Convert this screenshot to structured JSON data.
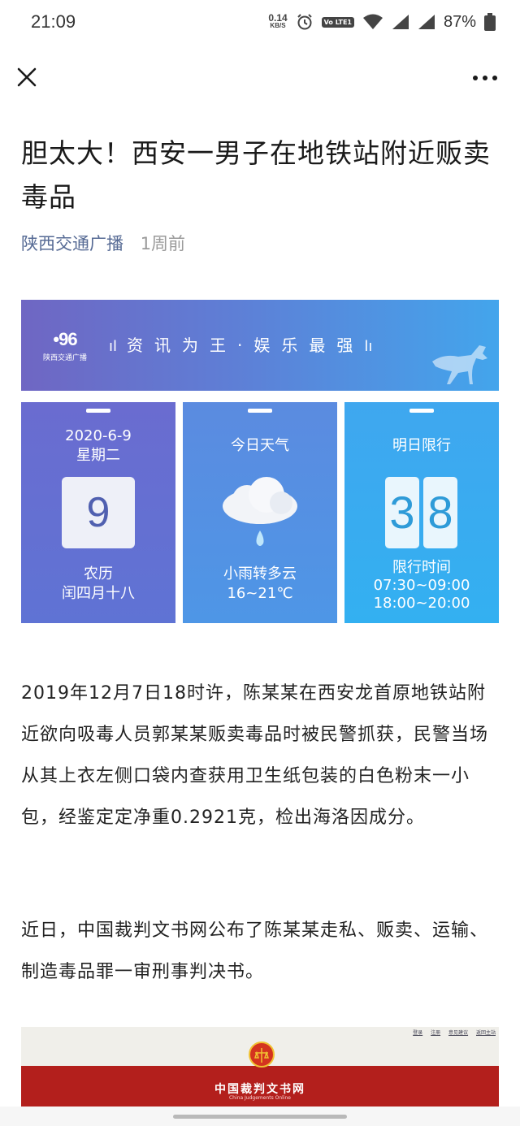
{
  "status_bar": {
    "time": "21:09",
    "net_speed_value": "0.14",
    "net_speed_unit": "KB/S",
    "volte_label": "Vo LTE1",
    "battery": "87%"
  },
  "nav": {
    "close_icon": "close-icon",
    "more_icon": "more-icon"
  },
  "article": {
    "title": "胆太大！西安一男子在地铁站附近贩卖毒品",
    "author": "陕西交通广播",
    "time": "1周前",
    "paragraphs": [
      "2019年12月7日18时许，陈某某在西安龙首原地铁站附近欲向吸毒人员郭某某贩卖毒品时被民警抓获，民警当场从其上衣左侧口袋内查获用卫生纸包装的白色粉末一小包，经鉴定定净重0.2921克，检出海洛因成分。",
      "近日，中国裁判文书网公布了陈某某走私、贩卖、运输、制造毒品罪一审刑事判决书。"
    ]
  },
  "banner": {
    "logo_mark": "•96",
    "logo_name": "陕西交通广播",
    "slogan": "资讯为王·娱乐最强",
    "card_date": {
      "date": "2020-6-9",
      "weekday": "星期二",
      "day": "9",
      "lunar_label": "农历",
      "lunar_date": "闰四月十八"
    },
    "card_weather": {
      "title": "今日天气",
      "condition": "小雨转多云",
      "temperature": "16~21℃"
    },
    "card_limit": {
      "title": "明日限行",
      "digit_1": "3",
      "digit_2": "8",
      "label": "限行时间",
      "time_1": "07:30~09:00",
      "time_2": "18:00~20:00"
    }
  },
  "court_image": {
    "links": [
      "登录",
      "注册",
      "意见建议",
      "返回主站"
    ],
    "name": "中国裁判文书网",
    "name_en": "China Judgements Online"
  }
}
